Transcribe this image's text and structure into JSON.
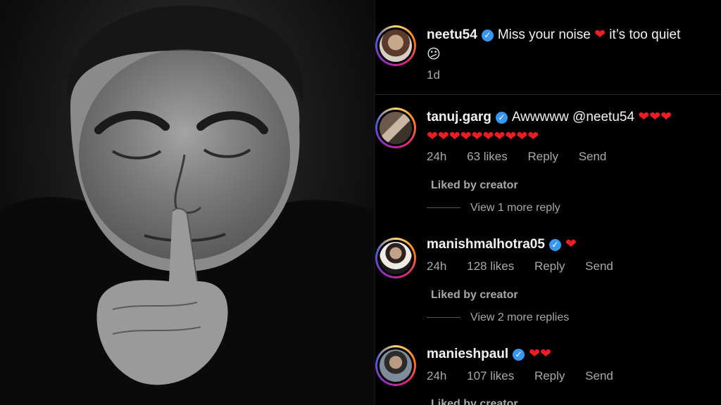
{
  "comments": [
    {
      "username": "neetu54",
      "text": "Miss your noise",
      "text_after": "it’s too quiet",
      "emoji_line2": "😕",
      "time": "1d"
    },
    {
      "username": "tanuj.garg",
      "text": "Awwwww @neetu54",
      "hearts_line1": "❤❤❤",
      "hearts_line2": "❤❤❤❤❤❤❤❤❤❤",
      "time": "24h",
      "likes": "63 likes",
      "reply": "Reply",
      "send": "Send",
      "liked_by": "Liked by creator",
      "view_more": "View 1 more reply"
    },
    {
      "username": "manishmalhotra05",
      "hearts": "❤",
      "time": "24h",
      "likes": "128 likes",
      "reply": "Reply",
      "send": "Send",
      "liked_by": "Liked by creator",
      "view_more": "View 2 more replies"
    },
    {
      "username": "manieshpaul",
      "hearts": "❤❤",
      "time": "24h",
      "likes": "107 likes",
      "reply": "Reply",
      "send": "Send",
      "liked_by": "Liked by creator"
    }
  ],
  "icons": {
    "verified": "verified-badge-icon",
    "heart": "heart-emoji"
  },
  "colors": {
    "verified": "#3897f0",
    "heart": "#ed1d24",
    "meta": "#a8a8a8",
    "background": "#000000"
  }
}
